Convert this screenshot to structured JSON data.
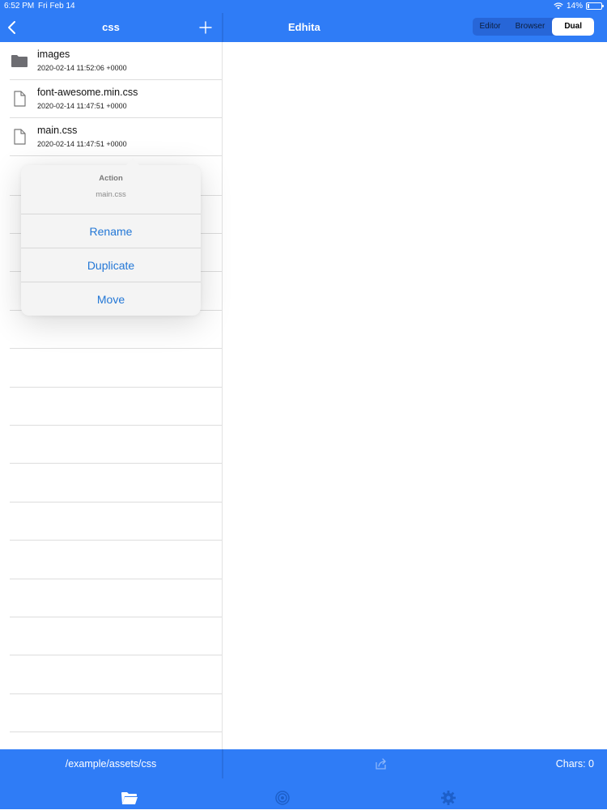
{
  "status": {
    "time": "6:52 PM",
    "date": "Fri Feb 14",
    "battery": "14%",
    "battery_level": 0.14
  },
  "nav": {
    "folder_title": "css",
    "app_title": "Edhita"
  },
  "view_modes": [
    {
      "label": "Editor",
      "active": false
    },
    {
      "label": "Browser",
      "active": false
    },
    {
      "label": "Dual",
      "active": true
    }
  ],
  "files": [
    {
      "name": "images",
      "date": "2020-02-14 11:52:06 +0000",
      "icon": "folder-icon"
    },
    {
      "name": "font-awesome.min.css",
      "date": "2020-02-14 11:47:51 +0000",
      "icon": "file-icon"
    },
    {
      "name": "main.css",
      "date": "2020-02-14 11:47:51 +0000",
      "icon": "file-icon"
    }
  ],
  "popover": {
    "title": "Action",
    "subtitle": "main.css",
    "actions": [
      "Rename",
      "Duplicate",
      "Move"
    ]
  },
  "footer": {
    "path": "/example/assets/css",
    "chars": "Chars: 0"
  },
  "tabs": [
    {
      "icon": "folder-icon"
    },
    {
      "icon": "target-icon"
    },
    {
      "icon": "gear-icon"
    }
  ],
  "colors": {
    "accent": "#2f7cf6",
    "action_text": "#2377d6"
  }
}
